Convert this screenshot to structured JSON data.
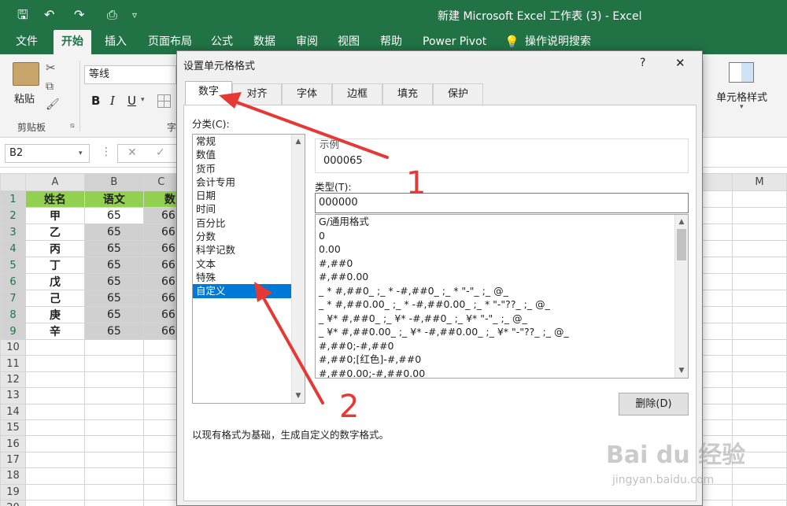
{
  "window": {
    "title": "新建 Microsoft Excel 工作表 (3) - Excel"
  },
  "quick_access": {
    "save": "🖫",
    "undo": "↶",
    "redo": "↷",
    "preview": "⎙",
    "more": "▿"
  },
  "menu": [
    "文件",
    "开始",
    "插入",
    "页面布局",
    "公式",
    "数据",
    "审阅",
    "视图",
    "帮助",
    "Power Pivot",
    "操作说明搜索"
  ],
  "ribbon": {
    "paste": "粘贴",
    "clipboard": "剪贴板",
    "font_name": "等线",
    "bold": "B",
    "italic": "I",
    "underline": "U",
    "font_group": "字",
    "cell_style": "单元格样式"
  },
  "namebox": "B2",
  "sheet": {
    "col_headers": [
      "A",
      "B",
      "C",
      "",
      "M"
    ],
    "rows": [
      {
        "n": "1",
        "a": "姓名",
        "b": "语文",
        "c": "数"
      },
      {
        "n": "2",
        "a": "甲",
        "b": "65",
        "c": "66"
      },
      {
        "n": "3",
        "a": "乙",
        "b": "65",
        "c": "66"
      },
      {
        "n": "4",
        "a": "丙",
        "b": "65",
        "c": "66"
      },
      {
        "n": "5",
        "a": "丁",
        "b": "65",
        "c": "66"
      },
      {
        "n": "6",
        "a": "戊",
        "b": "65",
        "c": "66"
      },
      {
        "n": "7",
        "a": "己",
        "b": "65",
        "c": "66"
      },
      {
        "n": "8",
        "a": "庚",
        "b": "65",
        "c": "66"
      },
      {
        "n": "9",
        "a": "辛",
        "b": "65",
        "c": "66"
      },
      {
        "n": "10"
      },
      {
        "n": "11"
      },
      {
        "n": "12"
      },
      {
        "n": "13"
      },
      {
        "n": "14"
      },
      {
        "n": "15"
      },
      {
        "n": "16"
      },
      {
        "n": "17"
      },
      {
        "n": "18"
      },
      {
        "n": "19"
      },
      {
        "n": "20"
      }
    ]
  },
  "dialog": {
    "title": "设置单元格格式",
    "help": "?",
    "close": "✕",
    "tabs": [
      "数字",
      "对齐",
      "字体",
      "边框",
      "填充",
      "保护"
    ],
    "category_label": "分类(C):",
    "categories": [
      "常规",
      "数值",
      "货币",
      "会计专用",
      "日期",
      "时间",
      "百分比",
      "分数",
      "科学记数",
      "文本",
      "特殊",
      "自定义"
    ],
    "selected_category": "自定义",
    "sample_label": "示例",
    "sample_value": "000065",
    "type_label": "类型(T):",
    "type_value": "000000",
    "formats": [
      "G/通用格式",
      "0",
      "0.00",
      "#,##0",
      "#,##0.00",
      "_ * #,##0_ ;_ * -#,##0_ ;_ * \"-\"_ ;_ @_",
      "_ * #,##0.00_ ;_ * -#,##0.00_ ;_ * \"-\"??_ ;_ @_",
      "_ ¥* #,##0_ ;_ ¥* -#,##0_ ;_ ¥* \"-\"_ ;_ @_",
      "_ ¥* #,##0.00_ ;_ ¥* -#,##0.00_ ;_ ¥* \"-\"??_ ;_ @_",
      "#,##0;-#,##0",
      "#,##0;[红色]-#,##0",
      "#,##0.00;-#,##0.00"
    ],
    "delete_button": "删除(D)",
    "description": "以现有格式为基础，生成自定义的数字格式。"
  },
  "annotations": {
    "one": "1",
    "two": "2"
  },
  "watermark": {
    "logo": "Bai du 经验",
    "url": "jingyan.baidu.com"
  },
  "colors": {
    "excel_green": "#217346",
    "header_fill": "#92d050",
    "selection": "#0078d7",
    "annotation": "#e53935"
  }
}
